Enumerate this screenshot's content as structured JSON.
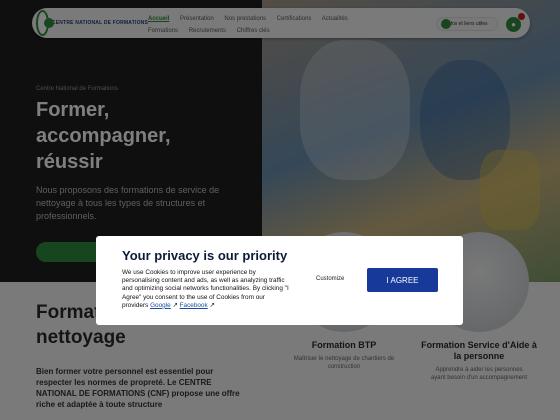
{
  "header": {
    "logo_text": "CENTRE NATIONAL DE FORMATIONS",
    "nav": [
      "Accueil",
      "Présentation",
      "Nos prestations",
      "Certifications",
      "Actualités",
      "Formations",
      "Recrutements",
      "Chiffres clés"
    ],
    "cta_label": "Infos et liens utiles",
    "cart_icon": "cart-icon"
  },
  "hero": {
    "kicker": "Centre National de Formations",
    "title": "Former, accompagner, réussir",
    "text": "Nous proposons des formations de service de nettoyage à tous les types de structures et professionnels."
  },
  "section": {
    "title": "Formation service de nettoyage",
    "text": "Bien former votre personnel est essentiel pour respecter les normes de propreté. Le CENTRE NATIONAL DE FORMATIONS (CNF) propose une offre riche et adaptée à toute structure"
  },
  "cards": [
    {
      "title": "Formation BTP",
      "desc": "Maîtriser le nettoyage de chantiers de construction"
    },
    {
      "title": "Formation Service d'Aide à la personne",
      "desc": "Apprendre à aider les personnes ayant besoin d'un accompagnement"
    }
  ],
  "cookie": {
    "title": "Your privacy is our priority",
    "body": "We use Cookies to improve user experience by personalising content and ads, as well as analyzing traffic and optimizing social networks functionalities. By clicking \"I Agree\" you consent to the use of Cookies from our providers",
    "link_google": "Google",
    "link_facebook": "Facebook",
    "customize_label": "Customize",
    "agree_label": "I AGREE"
  }
}
